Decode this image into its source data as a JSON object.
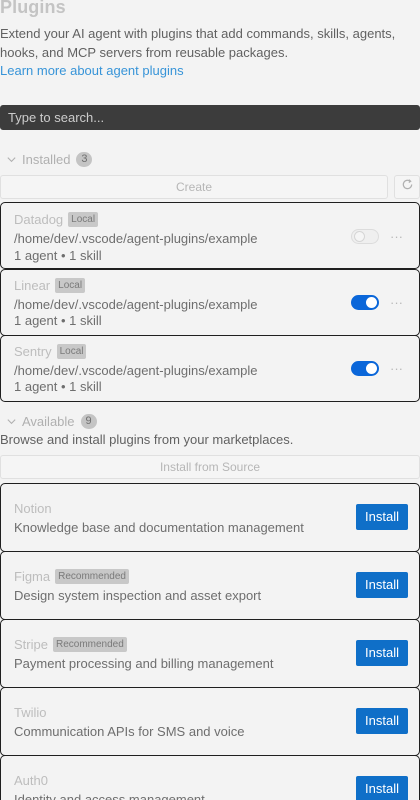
{
  "header": {
    "title": "Plugins",
    "intro": "Extend your AI agent with plugins that add commands, skills, agents, hooks, and MCP servers from reusable packages.",
    "learn_more": "Learn more about agent plugins"
  },
  "search": {
    "placeholder": "Type to search..."
  },
  "installed": {
    "title": "Installed",
    "count": "3",
    "create_label": "Create",
    "plugins": [
      {
        "name": "Datadog",
        "tag": "Local",
        "path": "/home/dev/.vscode/agent-plugins/example",
        "summary": "1 agent • 1 skill",
        "enabled": false,
        "more": "···"
      },
      {
        "name": "Linear",
        "tag": "Local",
        "path": "/home/dev/.vscode/agent-plugins/example",
        "summary": "1 agent • 1 skill",
        "enabled": true,
        "more": "···"
      },
      {
        "name": "Sentry",
        "tag": "Local",
        "path": "/home/dev/.vscode/agent-plugins/example",
        "summary": "1 agent • 1 skill",
        "enabled": true,
        "more": "···"
      }
    ]
  },
  "available": {
    "title": "Available",
    "count": "9",
    "subtitle": "Browse and install plugins from your marketplaces.",
    "install_source_label": "Install from Source",
    "plugins": [
      {
        "name": "Notion",
        "tag": "",
        "description": "Knowledge base and documentation management",
        "action": "Install"
      },
      {
        "name": "Figma",
        "tag": "Recommended",
        "description": "Design system inspection and asset export",
        "action": "Install"
      },
      {
        "name": "Stripe",
        "tag": "Recommended",
        "description": "Payment processing and billing management",
        "action": "Install"
      },
      {
        "name": "Twilio",
        "tag": "",
        "description": "Communication APIs for SMS and voice",
        "action": "Install"
      },
      {
        "name": "Auth0",
        "tag": "",
        "description": "Identity and access management",
        "action": "Install"
      }
    ]
  },
  "colors": {
    "accent": "#0f6fc8",
    "toggle_on": "#0a66d9",
    "link": "#3794d8"
  }
}
